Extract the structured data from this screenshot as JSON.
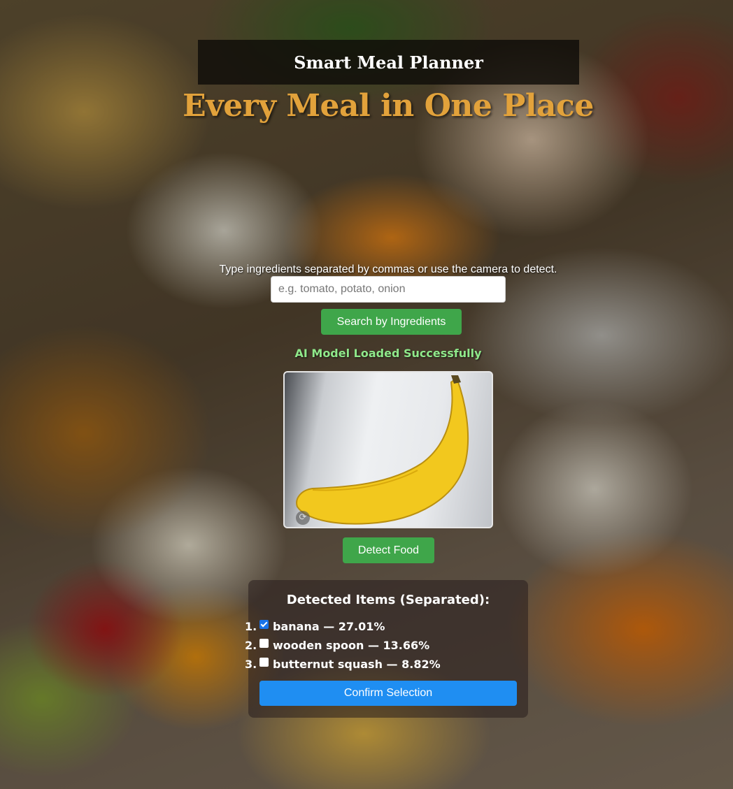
{
  "header": {
    "title": "Smart Meal Planner"
  },
  "hero": {
    "tagline": "Every Meal in One Place"
  },
  "search": {
    "hint": "Type ingredients separated by commas or use the camera to detect.",
    "placeholder": "e.g. tomato, potato, onion",
    "value": "",
    "button_label": "Search by Ingredients"
  },
  "status": {
    "text": "AI Model Loaded Successfully",
    "color": "#8fe88a"
  },
  "camera": {
    "switch_icon": "camera-switch-icon"
  },
  "detect": {
    "button_label": "Detect Food"
  },
  "results": {
    "title": "Detected Items (Separated):",
    "items": [
      {
        "num": "1.",
        "label": "banana — 27.01%",
        "checked": true
      },
      {
        "num": "2.",
        "label": "wooden spoon — 13.66%",
        "checked": false
      },
      {
        "num": "3.",
        "label": "butternut squash — 8.82%",
        "checked": false
      }
    ],
    "confirm_label": "Confirm Selection"
  },
  "colors": {
    "accent_gold": "#e2a23b",
    "button_green": "#3fa64a",
    "button_blue": "#1f8ef2"
  }
}
